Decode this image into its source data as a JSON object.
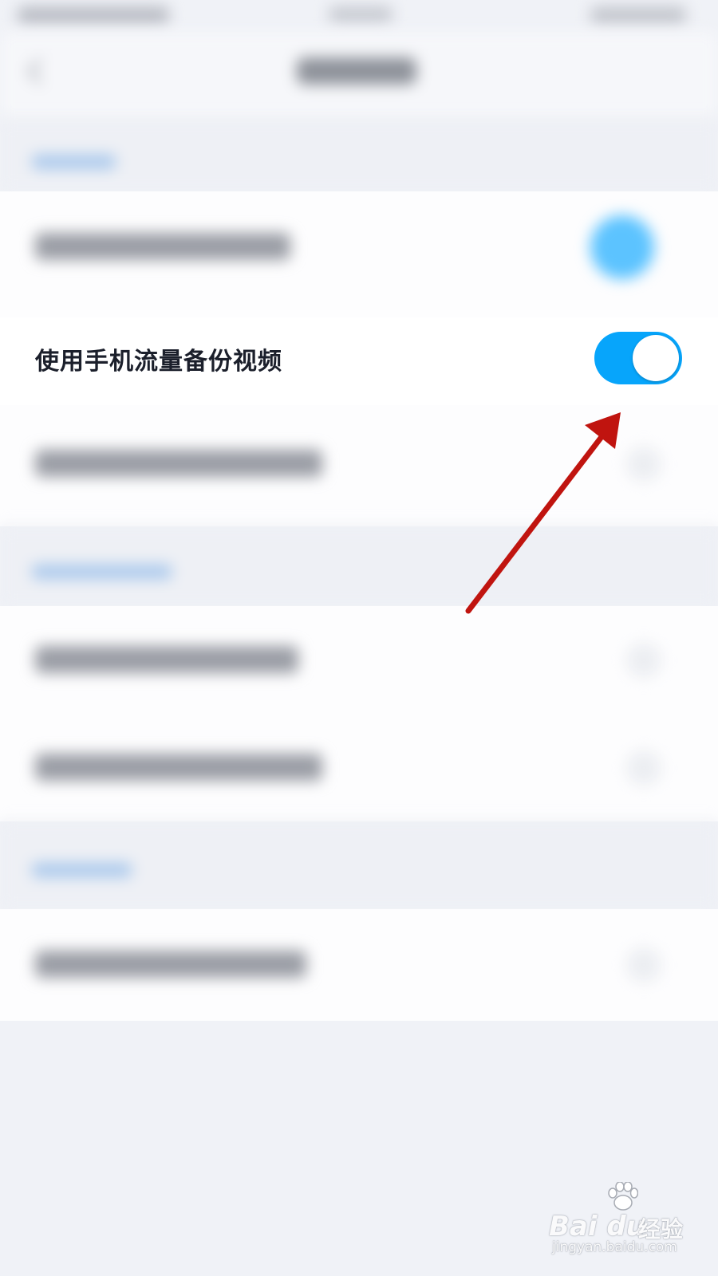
{
  "screen": {
    "background": "#f0f2f7"
  },
  "setting": {
    "label": "使用手机流量备份视频",
    "enabled": true,
    "toggle_color": "#07a5fb"
  },
  "annotation": {
    "arrow_color": "#c0140f"
  },
  "watermark": {
    "logo": "Bai du",
    "cn": "经验",
    "url": "jingyan.baidu.com"
  },
  "icons": {
    "back": "back-chevron-icon",
    "paw": "baidu-paw-icon",
    "arrow": "red-arrow-annotation"
  }
}
